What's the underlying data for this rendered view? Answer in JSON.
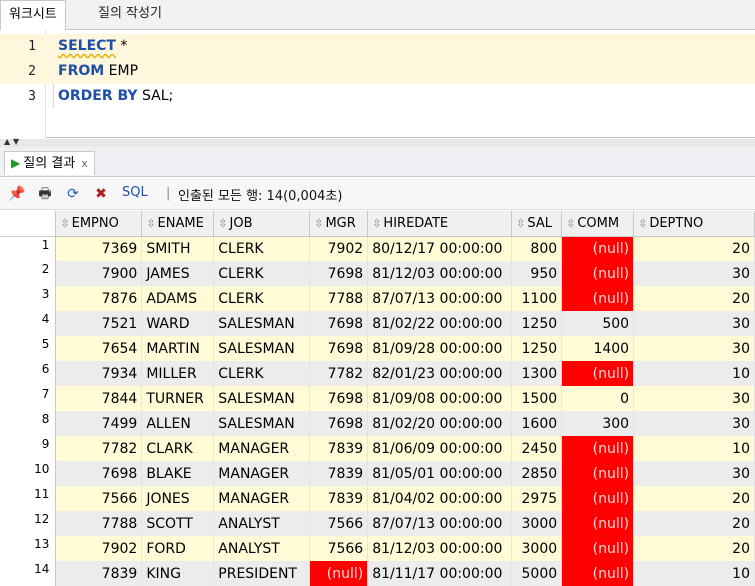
{
  "tabs": [
    {
      "label": "워크시트",
      "active": true
    },
    {
      "label": "질의 작성기",
      "active": false
    }
  ],
  "editor": {
    "lines": [
      {
        "num": "1",
        "keyword": "SELECT",
        "rest": " *"
      },
      {
        "num": "2",
        "keyword": "FROM",
        "rest": " EMP"
      },
      {
        "num": "3",
        "keyword": "ORDER BY",
        "rest": " SAL;"
      }
    ]
  },
  "result_tab": {
    "label": "질의 결과",
    "close": "x"
  },
  "toolbar": {
    "icons": [
      "pin-icon",
      "print-icon",
      "refresh-icon",
      "export-icon"
    ],
    "sql_label": "SQL",
    "separator": "|",
    "status": "인출된 모든 행: 14(0,004초)"
  },
  "grid": {
    "columns": [
      "EMPNO",
      "ENAME",
      "JOB",
      "MGR",
      "HIREDATE",
      "SAL",
      "COMM",
      "DEPTNO"
    ],
    "null_text": "(null)",
    "null_color": "#ff0000",
    "rows": [
      {
        "n": "1",
        "empno": "7369",
        "ename": "SMITH",
        "job": "CLERK",
        "mgr": "7902",
        "hiredate": "80/12/17 00:00:00",
        "sal": "800",
        "comm": null,
        "deptno": "20"
      },
      {
        "n": "2",
        "empno": "7900",
        "ename": "JAMES",
        "job": "CLERK",
        "mgr": "7698",
        "hiredate": "81/12/03 00:00:00",
        "sal": "950",
        "comm": null,
        "deptno": "30"
      },
      {
        "n": "3",
        "empno": "7876",
        "ename": "ADAMS",
        "job": "CLERK",
        "mgr": "7788",
        "hiredate": "87/07/13 00:00:00",
        "sal": "1100",
        "comm": null,
        "deptno": "20"
      },
      {
        "n": "4",
        "empno": "7521",
        "ename": "WARD",
        "job": "SALESMAN",
        "mgr": "7698",
        "hiredate": "81/02/22 00:00:00",
        "sal": "1250",
        "comm": "500",
        "deptno": "30"
      },
      {
        "n": "5",
        "empno": "7654",
        "ename": "MARTIN",
        "job": "SALESMAN",
        "mgr": "7698",
        "hiredate": "81/09/28 00:00:00",
        "sal": "1250",
        "comm": "1400",
        "deptno": "30"
      },
      {
        "n": "6",
        "empno": "7934",
        "ename": "MILLER",
        "job": "CLERK",
        "mgr": "7782",
        "hiredate": "82/01/23 00:00:00",
        "sal": "1300",
        "comm": null,
        "deptno": "10"
      },
      {
        "n": "7",
        "empno": "7844",
        "ename": "TURNER",
        "job": "SALESMAN",
        "mgr": "7698",
        "hiredate": "81/09/08 00:00:00",
        "sal": "1500",
        "comm": "0",
        "deptno": "30"
      },
      {
        "n": "8",
        "empno": "7499",
        "ename": "ALLEN",
        "job": "SALESMAN",
        "mgr": "7698",
        "hiredate": "81/02/20 00:00:00",
        "sal": "1600",
        "comm": "300",
        "deptno": "30"
      },
      {
        "n": "9",
        "empno": "7782",
        "ename": "CLARK",
        "job": "MANAGER",
        "mgr": "7839",
        "hiredate": "81/06/09 00:00:00",
        "sal": "2450",
        "comm": null,
        "deptno": "10"
      },
      {
        "n": "10",
        "empno": "7698",
        "ename": "BLAKE",
        "job": "MANAGER",
        "mgr": "7839",
        "hiredate": "81/05/01 00:00:00",
        "sal": "2850",
        "comm": null,
        "deptno": "30"
      },
      {
        "n": "11",
        "empno": "7566",
        "ename": "JONES",
        "job": "MANAGER",
        "mgr": "7839",
        "hiredate": "81/04/02 00:00:00",
        "sal": "2975",
        "comm": null,
        "deptno": "20"
      },
      {
        "n": "12",
        "empno": "7788",
        "ename": "SCOTT",
        "job": "ANALYST",
        "mgr": "7566",
        "hiredate": "87/07/13 00:00:00",
        "sal": "3000",
        "comm": null,
        "deptno": "20"
      },
      {
        "n": "13",
        "empno": "7902",
        "ename": "FORD",
        "job": "ANALYST",
        "mgr": "7566",
        "hiredate": "81/12/03 00:00:00",
        "sal": "3000",
        "comm": null,
        "deptno": "20"
      },
      {
        "n": "14",
        "empno": "7839",
        "ename": "KING",
        "job": "PRESIDENT",
        "mgr": null,
        "hiredate": "81/11/17 00:00:00",
        "sal": "5000",
        "comm": null,
        "deptno": "10"
      }
    ]
  }
}
